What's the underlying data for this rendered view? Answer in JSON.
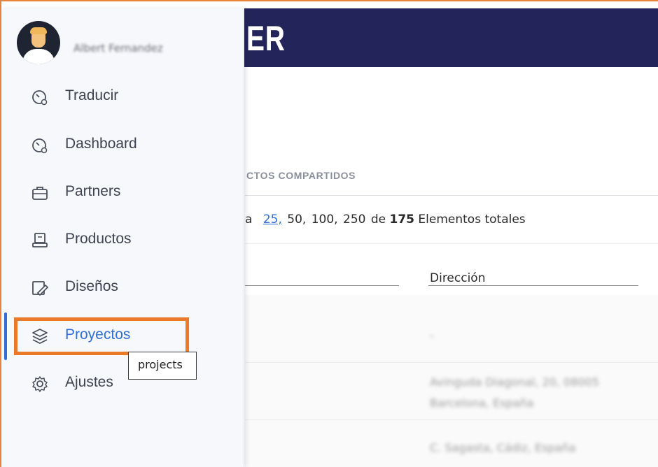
{
  "header": {
    "brand": "ER"
  },
  "user": {
    "name": "Albert Fernandez"
  },
  "sidebar": {
    "items": [
      {
        "label": "Traducir",
        "icon": "gauge-icon"
      },
      {
        "label": "Dashboard",
        "icon": "gauge-icon"
      },
      {
        "label": "Partners",
        "icon": "briefcase-icon"
      },
      {
        "label": "Productos",
        "icon": "machine-icon"
      },
      {
        "label": "Diseños",
        "icon": "design-pencil-icon"
      },
      {
        "label": "Proyectos",
        "icon": "layers-icon",
        "active": true
      },
      {
        "label": "Ajustes",
        "icon": "gear-icon"
      }
    ]
  },
  "tooltip": {
    "text": "projects"
  },
  "main": {
    "tab_label": "CTOS COMPARTIDOS",
    "pager": {
      "prefix": "a",
      "options": [
        "25,",
        "50,",
        "100,",
        "250"
      ],
      "selected": "25,",
      "de": "de",
      "total": "175",
      "suffix": "Elementos totales"
    },
    "columns": {
      "address": "Dirección"
    },
    "rows": [
      {
        "address": "-"
      },
      {
        "address": "Avinguda Diagonal, 20, 08005 Barcelona, España"
      },
      {
        "address": "C. Sagasta, Cádiz, España"
      }
    ]
  },
  "colors": {
    "header_bg": "#23255a",
    "accent": "#2f6fd6",
    "highlight": "#ea7a2a",
    "sidebar_bg": "#f7f8fb"
  }
}
